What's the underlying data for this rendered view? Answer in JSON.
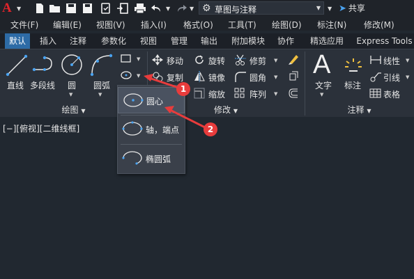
{
  "titlebar": {
    "logo": "A",
    "workspace": "草图与注释",
    "share": "共享"
  },
  "menubar": {
    "items": [
      "文件(F)",
      "编辑(E)",
      "视图(V)",
      "插入(I)",
      "格式(O)",
      "工具(T)",
      "绘图(D)",
      "标注(N)",
      "修改(M)"
    ]
  },
  "tabs": [
    "默认",
    "插入",
    "注释",
    "参数化",
    "视图",
    "管理",
    "输出",
    "附加模块",
    "协作",
    "精选应用",
    "Express Tools"
  ],
  "active_tab": "默认",
  "draw_panel": {
    "line": "直线",
    "polyline": "多段线",
    "circle": "圆",
    "arc": "圆弧",
    "footer": "绘图"
  },
  "modify_panel": {
    "move": "移动",
    "rotate": "旋转",
    "trim": "修剪",
    "copy": "复制",
    "mirror": "镜像",
    "fillet": "圆角",
    "stretch": "缩放",
    "array": "阵列",
    "footer": "修改"
  },
  "annotation_panel": {
    "text": "文字",
    "dimension": "标注",
    "linear": "线性",
    "leader": "引线",
    "table": "表格",
    "footer": "注释"
  },
  "viewport": {
    "label": "[−][俯视][二维线框]"
  },
  "ellipse_dropdown": {
    "items": [
      "圆心",
      "轴，端点",
      "椭圆弧"
    ],
    "highlighted": "圆心"
  },
  "annotations": {
    "badge1": "1",
    "badge2": "2"
  },
  "colors": {
    "accent_tab": "#2d6ba6",
    "logo": "#e0242b",
    "badge": "#e83c3c",
    "arrow": "#e83c3c",
    "share_icon": "#4aa3f0"
  }
}
